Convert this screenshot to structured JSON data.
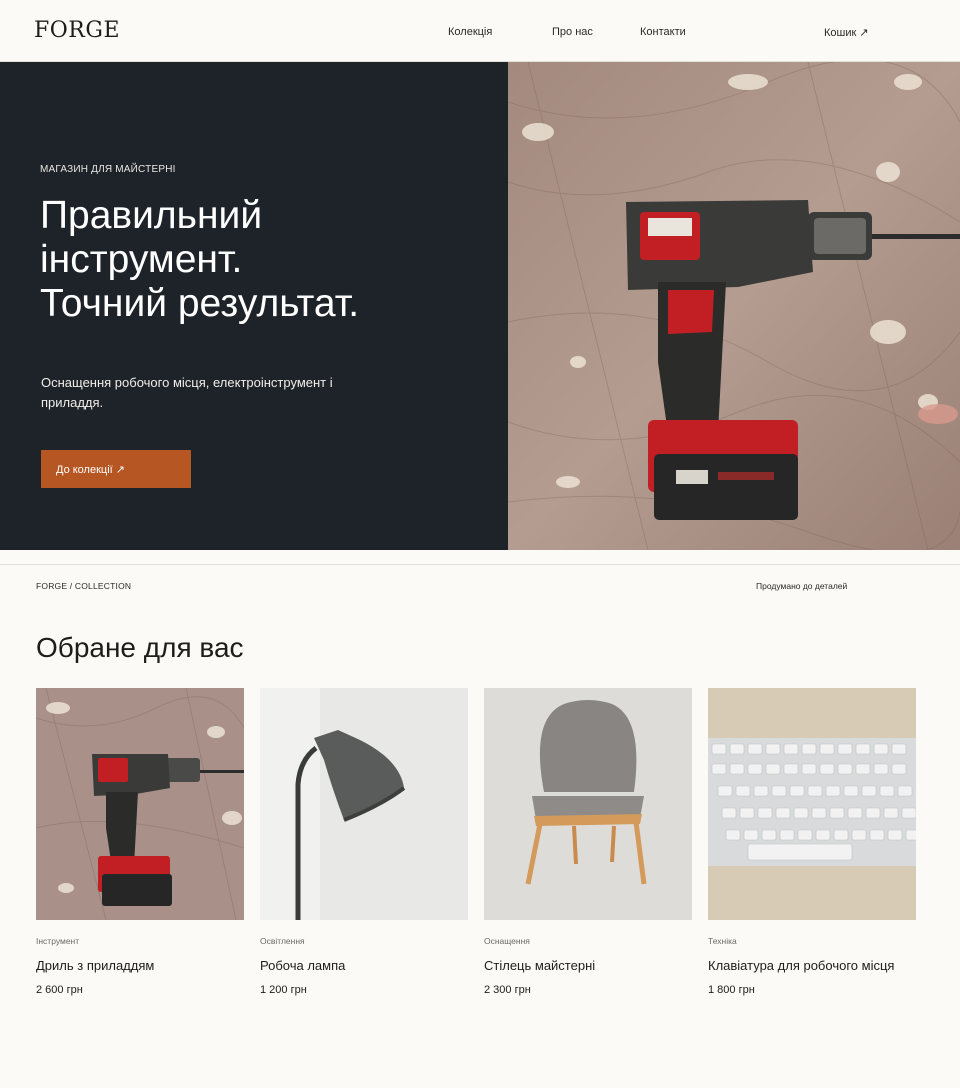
{
  "header": {
    "logo": "FORGE",
    "nav": [
      "Колекція",
      "Про нас",
      "Контакти"
    ],
    "cart": "Кошик ↗"
  },
  "hero": {
    "eyebrow": "МАГАЗИН ДЛЯ МАЙСТЕРНІ",
    "title_lines": [
      "Правильний",
      "інструмент.",
      "Точний результат."
    ],
    "description": "Оснащення робочого місця, електроінструмент і приладдя.",
    "cta": "До колекції ↗",
    "image_icon": "cordless-drill-photo"
  },
  "collection": {
    "breadcrumb": "FORGE / COLLECTION",
    "tagline": "Продумано до деталей",
    "title": "Обране для вас",
    "products": [
      {
        "category": "Інструмент",
        "name": "Дриль з приладдям",
        "price": "2 600 грн",
        "image": "drill-photo"
      },
      {
        "category": "Освітлення",
        "name": "Робоча лампа",
        "price": "1 200 грн",
        "image": "lamp-photo"
      },
      {
        "category": "Оснащення",
        "name": "Стілець майстерні",
        "price": "2 300 грн",
        "image": "chair-photo"
      },
      {
        "category": "Техніка",
        "name": "Клавіатура для робочого місця",
        "price": "1 800 грн",
        "image": "keyboard-photo"
      }
    ]
  },
  "colors": {
    "background": "#fbfaf6",
    "hero_dark": "#1e2329",
    "accent": "#b65622"
  }
}
